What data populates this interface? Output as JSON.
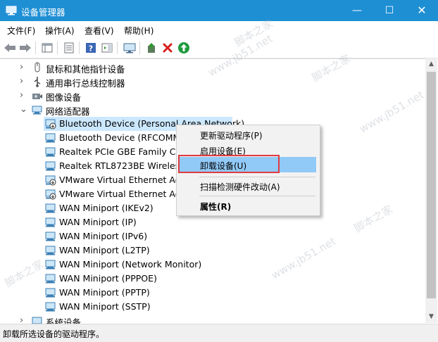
{
  "window": {
    "title": "设备管理器",
    "min": "—",
    "max": "☐",
    "close": "✕"
  },
  "menubar": [
    {
      "label": "文件(F)"
    },
    {
      "label": "操作(A)"
    },
    {
      "label": "查看(V)"
    },
    {
      "label": "帮助(H)"
    }
  ],
  "toolbar": {
    "icons": [
      "back-arrow-icon",
      "forward-arrow-icon",
      "show-hide-console-tree-icon",
      "properties-icon",
      "help-icon",
      "action-pane-icon",
      "computer-monitor-icon",
      "update-driver-icon",
      "uninstall-x-icon",
      "enable-device-icon"
    ]
  },
  "tree": {
    "categories_top": [
      {
        "label": "鼠标和其他指针设备",
        "icon": "mouse-icon"
      },
      {
        "label": "通用串行总线控制器",
        "icon": "usb-icon"
      },
      {
        "label": "图像设备",
        "icon": "camera-icon"
      }
    ],
    "network_category": {
      "label": "网络适配器",
      "icon": "network-adapter-icon"
    },
    "network_children": [
      {
        "label": "Bluetooth Device (Personal Area Network)",
        "disabled": true
      },
      {
        "label": "Bluetooth Device (RFCOMM",
        "disabled": false
      },
      {
        "label": "Realtek PCIe GBE Family Cor",
        "disabled": false
      },
      {
        "label": "Realtek RTL8723BE Wireless",
        "disabled": false
      },
      {
        "label": "VMware Virtual Ethernet Ada",
        "disabled": true
      },
      {
        "label": "VMware Virtual Ethernet Ada",
        "disabled": true
      },
      {
        "label": "WAN Miniport (IKEv2)",
        "disabled": false
      },
      {
        "label": "WAN Miniport (IP)",
        "disabled": false
      },
      {
        "label": "WAN Miniport (IPv6)",
        "disabled": false
      },
      {
        "label": "WAN Miniport (L2TP)",
        "disabled": false
      },
      {
        "label": "WAN Miniport (Network Monitor)",
        "disabled": false
      },
      {
        "label": "WAN Miniport (PPPOE)",
        "disabled": false
      },
      {
        "label": "WAN Miniport (PPTP)",
        "disabled": false
      },
      {
        "label": "WAN Miniport (SSTP)",
        "disabled": false
      }
    ],
    "category_bottom": {
      "label": "系统设备",
      "icon": "system-devices-icon"
    }
  },
  "context_menu": {
    "items": [
      {
        "label": "更新驱动程序(P)",
        "highlighted": false,
        "bold": false
      },
      {
        "label": "启用设备(E)",
        "highlighted": false,
        "bold": false
      },
      {
        "label": "卸载设备(U)",
        "highlighted": true,
        "bold": false
      },
      {
        "label": "扫描检测硬件改动(A)",
        "highlighted": false,
        "bold": false
      },
      {
        "label": "属性(R)",
        "highlighted": false,
        "bold": true
      }
    ]
  },
  "statusbar": {
    "text": "卸载所选设备的驱动程序。"
  },
  "watermarks": [
    "脚本之家",
    "www.jb51.net",
    "脚本之家",
    "www.jb51.net",
    "脚本之家",
    "www.jb51.net",
    "脚本之家"
  ],
  "colors": {
    "titlebar": "#1f8fd4",
    "selection": "#cce8ff",
    "menu_highlight": "#91c9f7",
    "callout_red": "#e03a3e"
  }
}
